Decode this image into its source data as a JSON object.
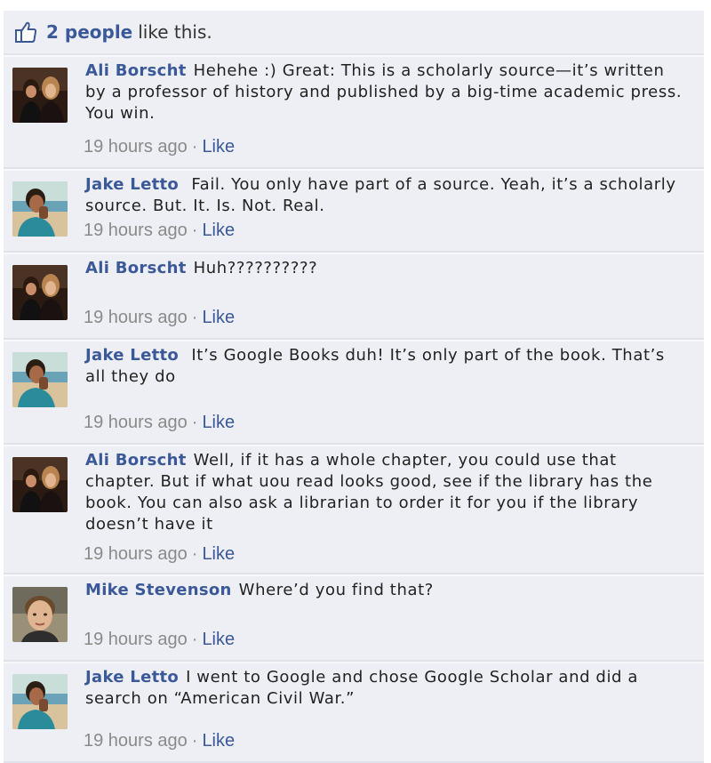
{
  "likes": {
    "count_link": "2 people",
    "rest": "like this."
  },
  "comments": [
    {
      "author": "Ali Borscht",
      "text": "Hehehe :) Great: This is a scholarly source—it’s written by a professor of history and published by a big-time academic press. You win.",
      "time": "19 hours ago",
      "like": "Like",
      "avatar_icon": "couple-photo"
    },
    {
      "author": "Jake Letto",
      "text": " Fail. You only have part of a source. Yeah, it’s a scholarly source. But. It. Is. Not. Real.",
      "time": "19 hours ago",
      "like": "Like",
      "avatar_icon": "beach-photo"
    },
    {
      "author": "Ali Borscht",
      "text": "Huh??????????",
      "time": "19 hours ago",
      "like": "Like",
      "avatar_icon": "couple-photo"
    },
    {
      "author": "Jake Letto",
      "text": " It’s Google Books duh! It’s only part of the book. That’s all they do",
      "time": "19 hours ago",
      "like": "Like",
      "avatar_icon": "beach-photo"
    },
    {
      "author": "Ali Borscht",
      "text": "Well, if it has a whole chapter, you could use that chapter. But if what uou read looks good, see if the library has the book. You can also ask a librarian to order it for you if the library doesn’t have it",
      "time": "19 hours ago",
      "like": "Like",
      "avatar_icon": "couple-photo"
    },
    {
      "author": "Mike Stevenson",
      "text": "Where’d you find that?",
      "time": "19 hours ago",
      "like": "Like",
      "avatar_icon": "man-portrait"
    },
    {
      "author": "Jake Letto",
      "text": "I went to Google and chose Google Scholar and did a search on “American Civil War.”",
      "time": "19 hours ago",
      "like": "Like",
      "avatar_icon": "beach-photo"
    }
  ],
  "separator": "·",
  "colors": {
    "link": "#3b5998",
    "background": "#edeff4",
    "timestamp": "#8a8a8a"
  }
}
